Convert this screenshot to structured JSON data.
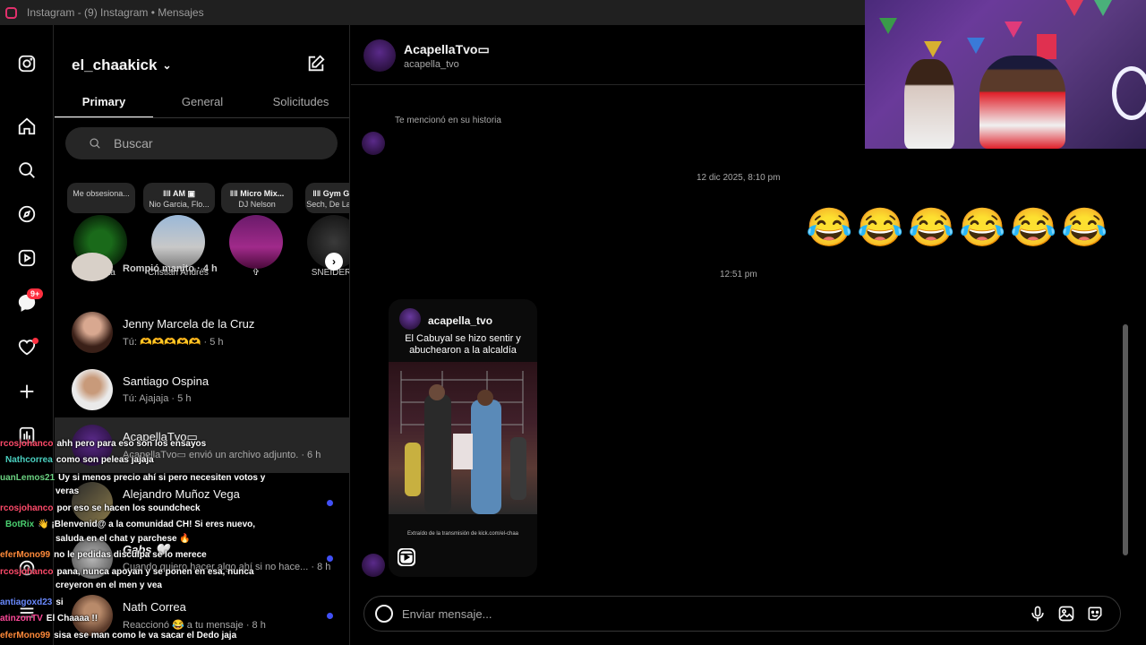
{
  "window": {
    "title": "Instagram - (9) Instagram • Mensajes"
  },
  "rail": {
    "notifications_badge": "9+"
  },
  "inbox": {
    "username": "el_chaakick",
    "tabs": [
      "Primary",
      "General",
      "Solicitudes"
    ],
    "search_placeholder": "Buscar",
    "notes": [
      {
        "bubble": "Me obsesiona...",
        "name": "Tu nota"
      },
      {
        "bubble_title": "ǁǁ AM ▣",
        "bubble_sub": "Nio Garcia, Flo...",
        "name": "Cristian Andrés"
      },
      {
        "bubble_title": "ǁǁ Micro Mix...",
        "bubble_sub": "DJ Nelson",
        "name": "✞"
      },
      {
        "bubble_title": "ǁǁ Gym Gi",
        "bubble_sub": "Sech, De La F",
        "name": "SNEIDER"
      }
    ],
    "threads": [
      {
        "name": "",
        "preview": "Rompió manito · 4 h",
        "unread": false
      },
      {
        "name": "Jenny Marcela de la Cruz",
        "preview": "Tú: 🫶🫶🫶🫶🫶 · 5 h",
        "unread": false
      },
      {
        "name": "Santiago Ospina",
        "preview": "Tú: Ajajaja · 5 h",
        "unread": false
      },
      {
        "name": "AcapellaTvo▭",
        "preview": "AcapellaTvo▭ envió un archivo adjunto. · 6 h",
        "unread": false
      },
      {
        "name": "Alejandro Muñoz Vega",
        "preview": "",
        "unread": true
      },
      {
        "name": "Gabs 🤍",
        "preview": "Cuando quiero hacer algo ahí si no hace... · 8 h",
        "unread": true
      },
      {
        "name": "Nath Correa",
        "preview": "Reaccionó 😂 a tu mensaje · 8 h",
        "unread": true
      }
    ]
  },
  "stream_chat": [
    {
      "user": "rcosjohanco",
      "msg": "ahh pero para eso son los ensayos",
      "color": "#ff4a6a"
    },
    {
      "user": "Nathcorrea",
      "msg": "como son peleas jajaja",
      "color": "#4ad0c0"
    },
    {
      "user": "uanLemos21",
      "msg": "Uy si menos precio ahí si pero necesiten votos y",
      "color": "#6ad080"
    },
    {
      "user": "",
      "msg": "veras",
      "color": "#ffffff"
    },
    {
      "user": "rcosjohanco",
      "msg": "por eso se hacen los soundcheck",
      "color": "#ff4a6a"
    },
    {
      "user": "BotRix",
      "msg": "👋 ¡Blenvenid@ a la comunidad CH! Si eres nuevo,",
      "color": "#4ad070"
    },
    {
      "user": "",
      "msg": "saluda en el chat y parchese 🔥",
      "color": "#ffffff"
    },
    {
      "user": "eferMono99",
      "msg": "no le pedidas disculpa se lo merece",
      "color": "#ff8a3a"
    },
    {
      "user": "rcosjohanco",
      "msg": "pana, nunca apoyan y se ponen en esa, nunca",
      "color": "#ff4a6a"
    },
    {
      "user": "",
      "msg": "creyeron en el men y vea",
      "color": "#ffffff"
    },
    {
      "user": "antiagoxd23",
      "msg": "si",
      "color": "#6a8aff"
    },
    {
      "user": "atinzonTV",
      "msg": "El Chaaaa !!",
      "color": "#ff4a9a"
    },
    {
      "user": "eferMono99",
      "msg": "sisa ese man como le va sacar el Dedo jaja",
      "color": "#ff8a3a"
    }
  ],
  "chat": {
    "name": "AcapellaTvo▭",
    "handle": "acapella_tvo",
    "mention_text": "Te mencionó en su historia",
    "date1": "12 dic 2025, 8:10 pm",
    "emojis": [
      "😂",
      "😂",
      "😂",
      "😂",
      "😂",
      "😂"
    ],
    "time2": "12:51 pm",
    "reel": {
      "username": "acapella_tvo",
      "caption": "El Cabuyal se hizo sentir y abuchearon a la alcaldía",
      "footer": "Extraído de la transmisión de kick.com/el-chaa"
    },
    "composer_placeholder": "Enviar mensaje..."
  },
  "colors": {
    "accent_unread": "#4150f7",
    "badge": "#ff3040"
  }
}
